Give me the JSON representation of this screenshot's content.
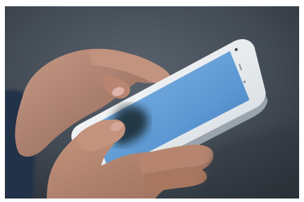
{
  "photo": {
    "subject": "hands-holding-smartphone",
    "colors": {
      "background_dark": "#2f3740",
      "background_mid": "#4a535d",
      "skin": "#b98c79",
      "skin_shadow": "#7a564a",
      "phone_body": "#e9eef2",
      "screen_top": "#78aee0",
      "screen_bottom": "#4d86c4"
    }
  }
}
